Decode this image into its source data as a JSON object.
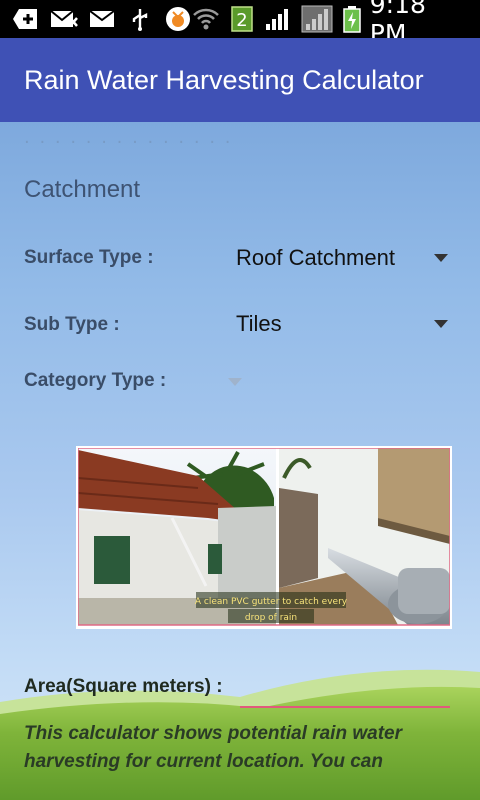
{
  "status_bar": {
    "time": "9:18 PM",
    "notification_badge": "2",
    "icons": [
      "plus-icon",
      "mail-muted-icon",
      "mail-icon",
      "usb-icon",
      "app-icon",
      "wifi-icon",
      "badge-icon",
      "signal-icon",
      "signal-empty-icon",
      "battery-charging-icon"
    ]
  },
  "app_bar": {
    "title": "Rain Water Harvesting Calculator",
    "color": "#3f51b5"
  },
  "form": {
    "section_title": "Catchment",
    "surface_type": {
      "label": "Surface Type :",
      "value": "Roof Catchment"
    },
    "sub_type": {
      "label": "Sub Type :",
      "value": "Tiles"
    },
    "category_type": {
      "label": "Category Type :",
      "value": ""
    },
    "image_caption": [
      "A clean PVC gutter to catch every",
      "drop of rain"
    ],
    "area": {
      "label": "Area(Square meters) :",
      "value": "",
      "placeholder": ""
    },
    "description": "This calculator shows potential rain water harvesting for current location. You can"
  }
}
